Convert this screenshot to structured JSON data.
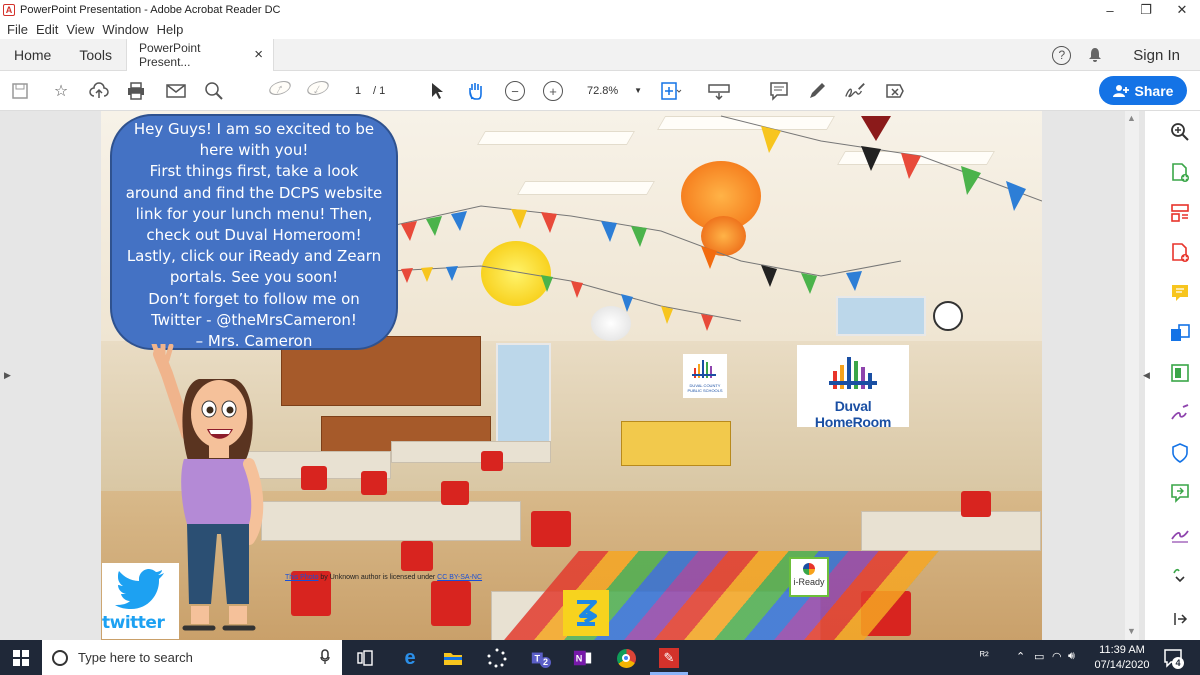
{
  "window": {
    "title": "PowerPoint Presentation - Adobe Acrobat Reader DC",
    "controls": [
      "–",
      "❐",
      "✕"
    ]
  },
  "menu": [
    "File",
    "Edit",
    "View",
    "Window",
    "Help"
  ],
  "tabs": {
    "home": "Home",
    "tools": "Tools",
    "document": "PowerPoint Present...",
    "close": "×",
    "help": "?",
    "signin": "Sign In"
  },
  "toolbar": {
    "page_current": "1",
    "page_total": "/ 1",
    "zoom": "72.8%",
    "share": "Share"
  },
  "slide": {
    "bubble_lines": [
      "Hey Guys!  I am so excited to be",
      "here with you!",
      "First things first, take a look",
      "around and find the DCPS website",
      "link for your lunch menu! Then,",
      "check out Duval Homeroom!",
      "Lastly, click our iReady and Zearn",
      "portals. See you soon!",
      "Don’t forget to follow me on",
      "Twitter - @theMrsCameron!",
      "– Mrs. Cameron"
    ],
    "duval_homeroom": "Duval HomeRoom",
    "duval_small": "DUVAL COUNTY PUBLIC SCHOOLS",
    "iready": "i-Ready",
    "twitter_word": "twitter",
    "credit": {
      "link1": "This Photo",
      "mid": " by Unknown author is licensed under ",
      "link2": "CC BY-SA-NC"
    }
  },
  "taskbar": {
    "search_placeholder": "Type here to search",
    "time": "11:39 AM",
    "date": "07/14/2020",
    "notification_count": "4",
    "teams_badge": "2"
  },
  "colors": {
    "share_button": "#1473e6",
    "bubble": "#4472c4",
    "taskbar": "#1f2838"
  }
}
